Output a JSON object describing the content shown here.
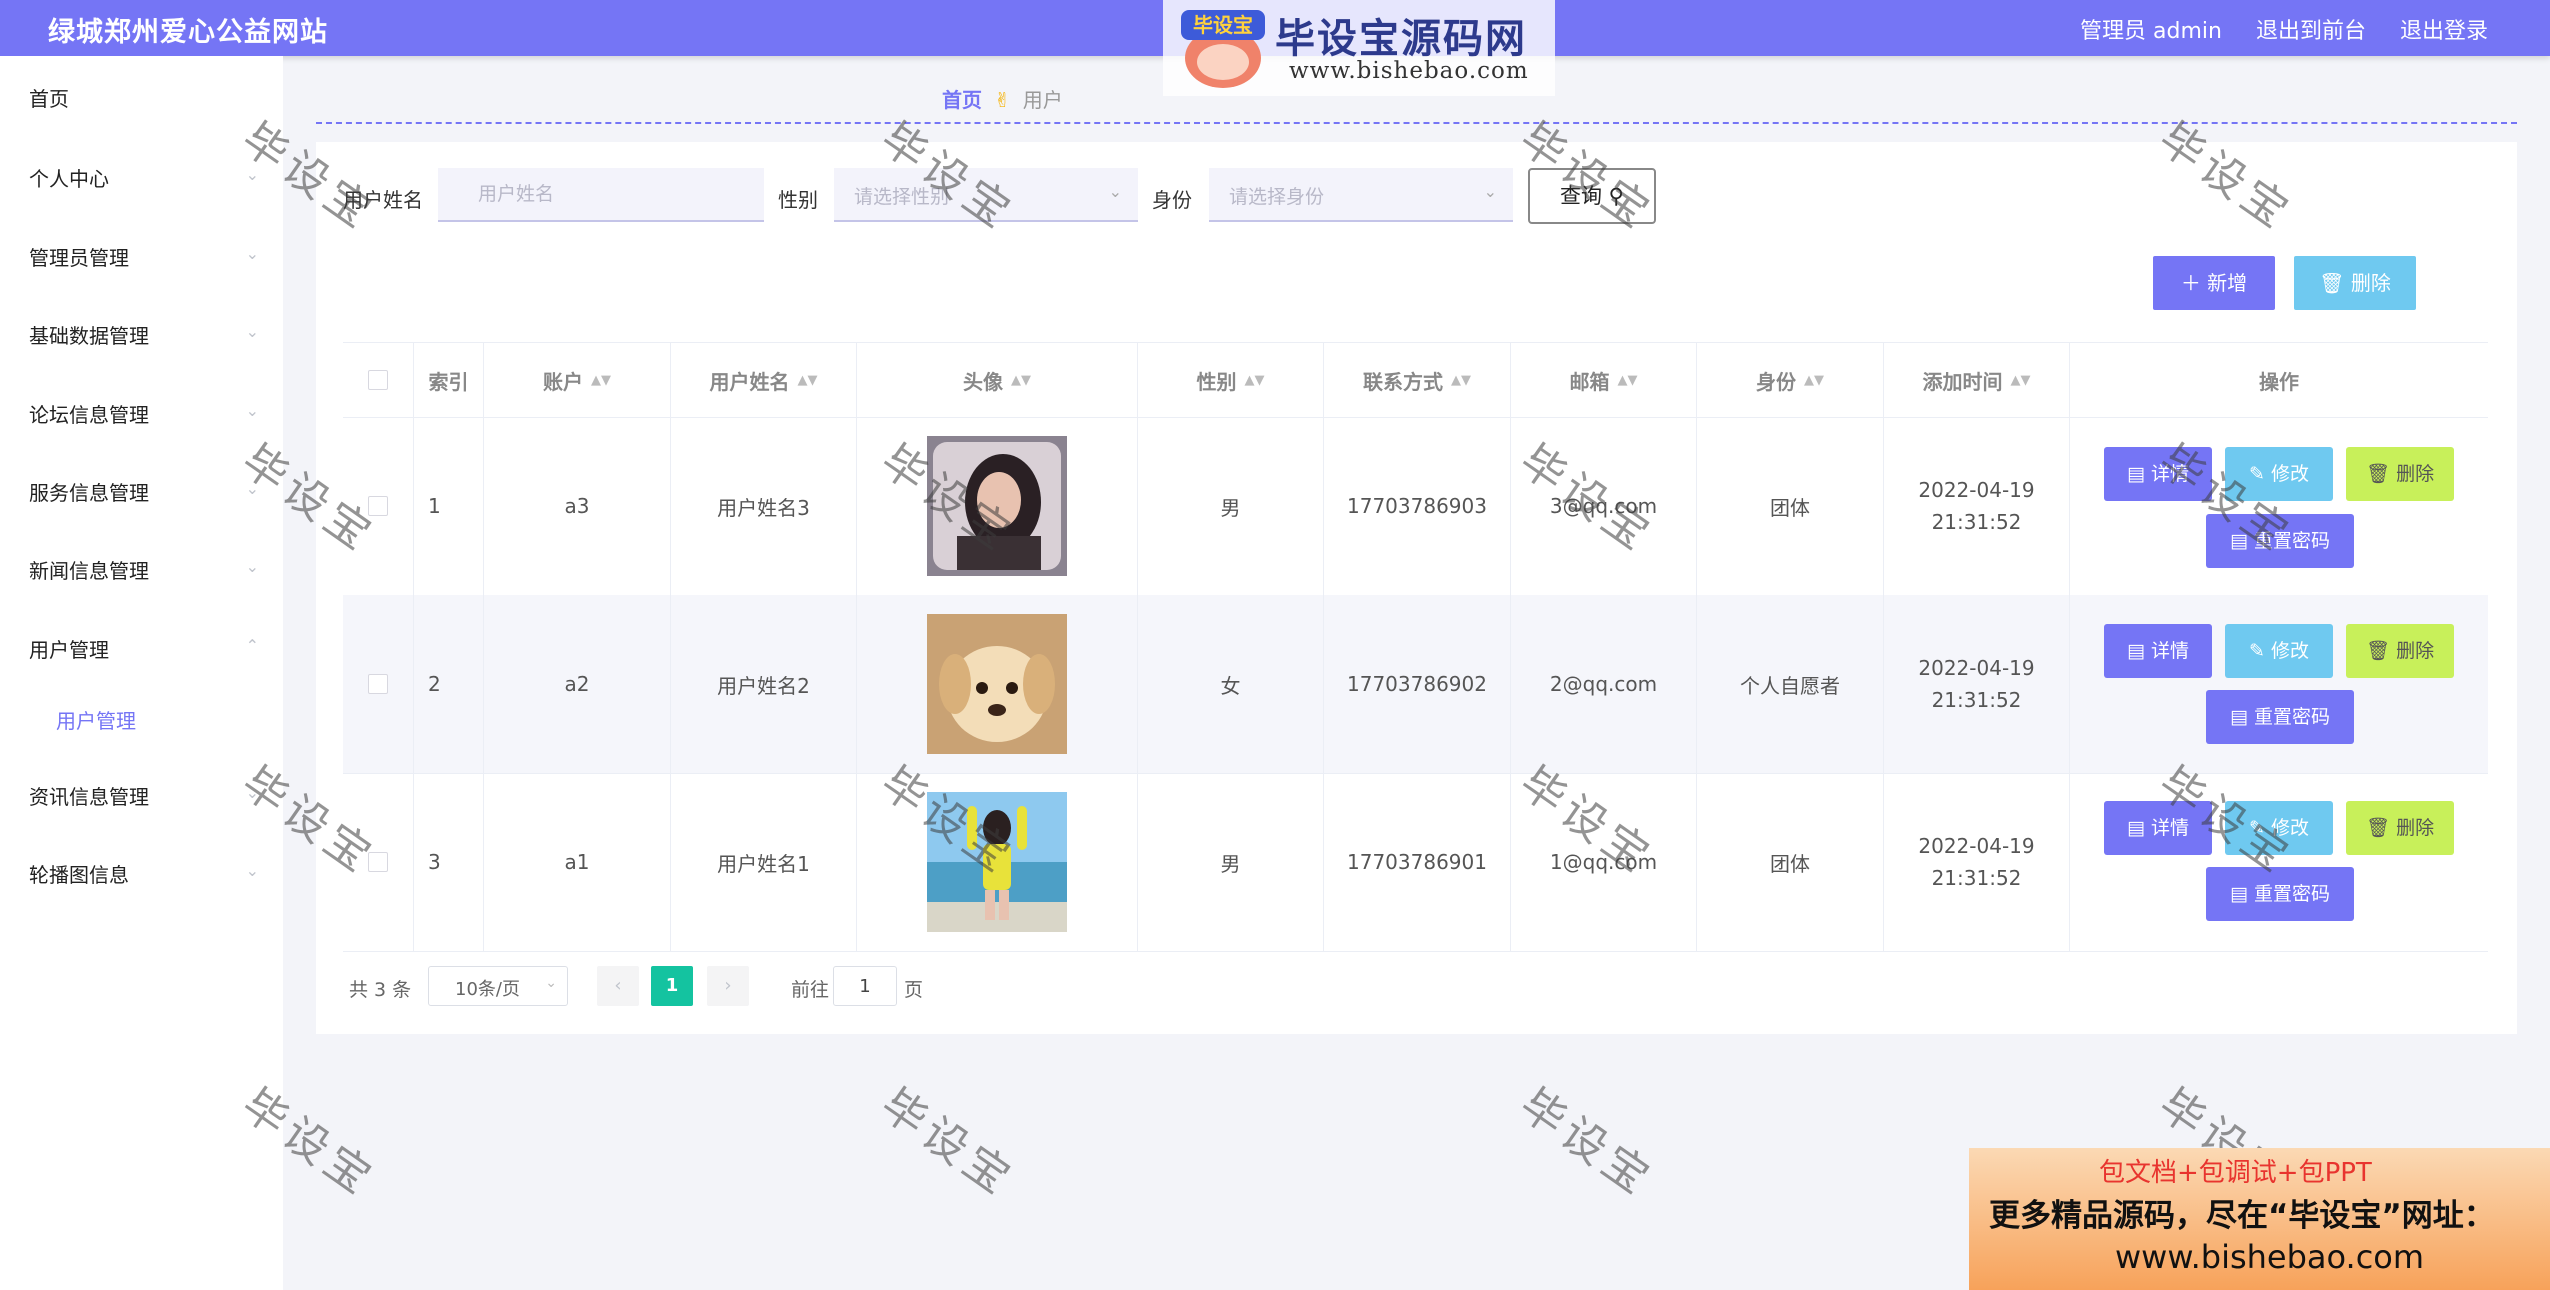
{
  "header": {
    "title": "绿城郑州爱心公益网站",
    "nav": [
      "管理员 admin",
      "退出到前台",
      "退出登录"
    ]
  },
  "brand": {
    "badge_text": "毕设宝",
    "title": "毕设宝源码网",
    "url": "www.bishebao.com"
  },
  "sidebar": {
    "items": [
      {
        "label": "首页",
        "icon": "none"
      },
      {
        "label": "个人中心",
        "icon": "chevron-down"
      },
      {
        "label": "管理员管理",
        "icon": "chevron-down"
      },
      {
        "label": "基础数据管理",
        "icon": "chevron-down"
      },
      {
        "label": "论坛信息管理",
        "icon": "chevron-down"
      },
      {
        "label": "服务信息管理",
        "icon": "chevron-down"
      },
      {
        "label": "新闻信息管理",
        "icon": "chevron-down"
      },
      {
        "label": "用户管理",
        "icon": "chevron-up"
      },
      {
        "label": "资讯信息管理",
        "icon": "chevron-down"
      },
      {
        "label": "轮播图信息",
        "icon": "chevron-down"
      }
    ],
    "sub_item": "用户管理"
  },
  "breadcrumb": {
    "home": "首页",
    "current": "用户"
  },
  "search": {
    "name_label": "用户姓名",
    "name_placeholder": "用户姓名",
    "gender_label": "性别",
    "gender_placeholder": "请选择性别",
    "role_label": "身份",
    "role_placeholder": "请选择身份",
    "query_button": "查询"
  },
  "actions": {
    "add": "新增",
    "delete": "删除"
  },
  "table": {
    "headers": [
      "索引",
      "账户",
      "用户姓名",
      "头像",
      "性别",
      "联系方式",
      "邮箱",
      "身份",
      "添加时间",
      "操作"
    ],
    "rows": [
      {
        "index": "1",
        "account": "a3",
        "name": "用户姓名3",
        "avatar": "woman-portrait-pillow",
        "gender": "男",
        "phone": "17703786903",
        "email": "3@qq.com",
        "role": "团体",
        "time": "2022-04-19 21:31:52"
      },
      {
        "index": "2",
        "account": "a2",
        "name": "用户姓名2",
        "avatar": "puppy",
        "gender": "女",
        "phone": "17703786902",
        "email": "2@qq.com",
        "role": "个人自愿者",
        "time": "2022-04-19 21:31:52"
      },
      {
        "index": "3",
        "account": "a1",
        "name": "用户姓名1",
        "avatar": "girl-at-beach",
        "gender": "男",
        "phone": "17703786901",
        "email": "1@qq.com",
        "role": "团体",
        "time": "2022-04-19 21:31:52"
      }
    ],
    "row_buttons": {
      "detail": "详情",
      "edit": "修改",
      "delete": "删除",
      "reset": "重置密码"
    }
  },
  "pagination": {
    "total": "共 3 条",
    "page_size": "10条/页",
    "current_page": "1",
    "goto_label": "前往",
    "goto_value": "1",
    "page_suffix": "页"
  },
  "watermark": "毕设宝",
  "ad": {
    "line1": "包文档+包调试+包PPT",
    "line2": "更多精品源码，尽在“毕设宝”网址：",
    "line3": "www.bishebao.com"
  },
  "colors": {
    "primary": "#7575f5",
    "info": "#6fc9f0",
    "warning": "#c8f05a",
    "pager_active": "#14c3a0"
  }
}
